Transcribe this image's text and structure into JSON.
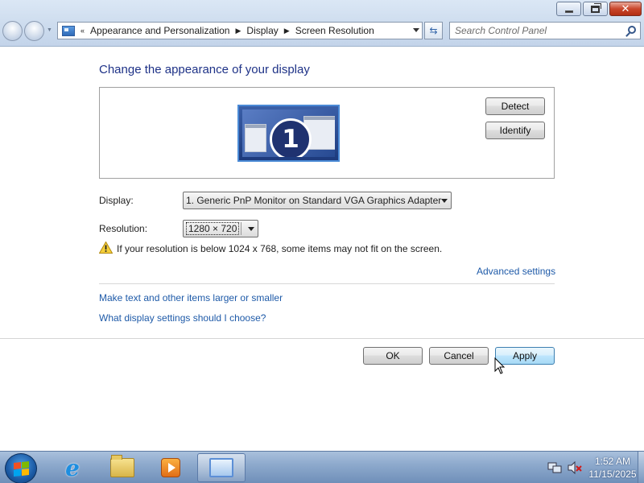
{
  "window": {
    "controls": {
      "minimize_icon": "minimize-icon",
      "maximize_icon": "restore-icon",
      "close_icon": "close-icon"
    }
  },
  "address_bar": {
    "breadcrumb": [
      "Appearance and Personalization",
      "Display",
      "Screen Resolution"
    ]
  },
  "search": {
    "placeholder": "Search Control Panel"
  },
  "content": {
    "title": "Change the appearance of your display",
    "monitor_number": "1",
    "detect_label": "Detect",
    "identify_label": "Identify",
    "display_label": "Display:",
    "display_value": "1. Generic PnP Monitor on Standard VGA Graphics Adapter",
    "resolution_label": "Resolution:",
    "resolution_value": "1280 × 720",
    "warning_text": "If your resolution is below 1024 x 768, some items may not fit on the screen.",
    "advanced_link": "Advanced settings",
    "larger_link": "Make text and other items larger or smaller",
    "choose_link": "What display settings should I choose?",
    "ok_label": "OK",
    "cancel_label": "Cancel",
    "apply_label": "Apply"
  },
  "taskbar": {
    "apps": [
      "internet-explorer-icon",
      "windows-explorer-icon",
      "windows-media-player-icon",
      "control-panel-icon"
    ],
    "time": "1:52 AM",
    "date": "11/15/2025"
  },
  "colors": {
    "link": "#1e5aa8",
    "title": "#1e3287",
    "taskbar": "#8eaacd"
  }
}
